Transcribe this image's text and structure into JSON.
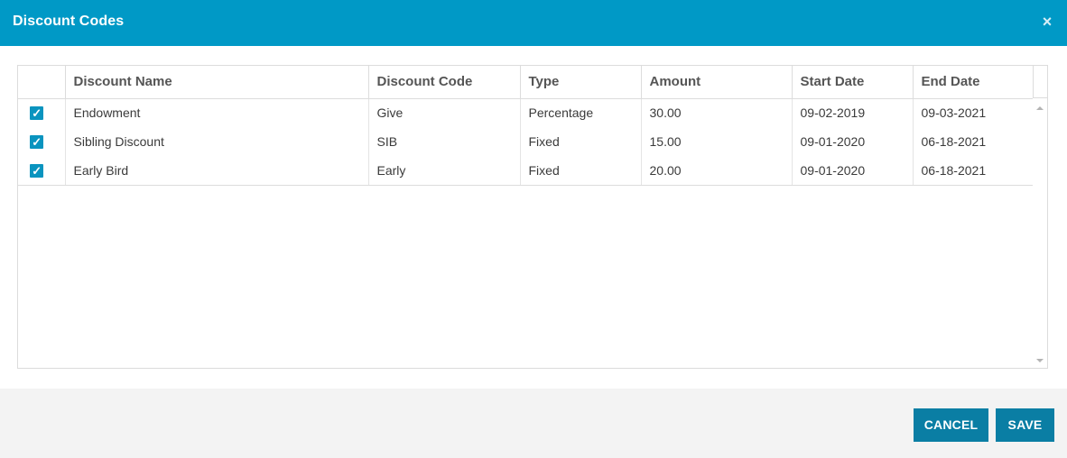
{
  "dialog": {
    "title": "Discount Codes",
    "close_glyph": "×"
  },
  "table": {
    "columns": [
      "Discount Name",
      "Discount Code",
      "Type",
      "Amount",
      "Start Date",
      "End Date"
    ],
    "rows": [
      {
        "checked": true,
        "check_glyph": "✓",
        "name": "Endowment",
        "code": "Give",
        "type": "Percentage",
        "amount": "30.00",
        "start": "09-02-2019",
        "end": "09-03-2021"
      },
      {
        "checked": true,
        "check_glyph": "✓",
        "name": "Sibling Discount",
        "code": "SIB",
        "type": "Fixed",
        "amount": "15.00",
        "start": "09-01-2020",
        "end": "06-18-2021"
      },
      {
        "checked": true,
        "check_glyph": "✓",
        "name": "Early Bird",
        "code": "Early",
        "type": "Fixed",
        "amount": "20.00",
        "start": "09-01-2020",
        "end": "06-18-2021"
      }
    ]
  },
  "footer": {
    "cancel_label": "CANCEL",
    "save_label": "SAVE"
  },
  "colors": {
    "titlebar": "#0099c6",
    "checkbox": "#0a94bf",
    "button": "#0a7ea4",
    "footer_bg": "#f3f3f3"
  }
}
